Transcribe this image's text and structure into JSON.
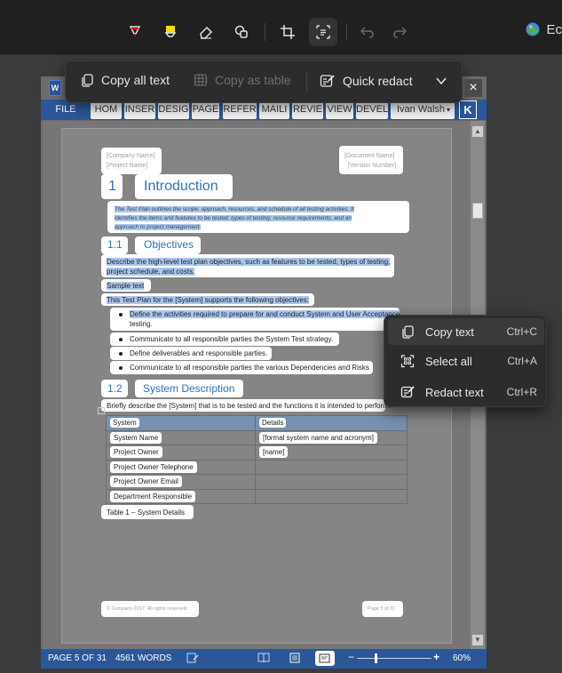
{
  "toolbar": {
    "right_label": "Ec"
  },
  "copy_bar": {
    "copy_all_text": "Copy all text",
    "copy_as_table": "Copy as table",
    "quick_redact": "Quick redact"
  },
  "close_label": "×",
  "ribbon": {
    "file": "FILE",
    "tabs": [
      "HOM",
      "INSER",
      "DESIG",
      "PAGE",
      "REFER",
      "MAILI",
      "REVIE",
      "VIEW",
      "DEVEL"
    ],
    "user": "Ivan Walsh",
    "user_initial": "K"
  },
  "document": {
    "company_name": "[Company Name]",
    "project_name": "[Project Name]",
    "document_name": "[Document Name]",
    "version_number": "[Version Number]",
    "h1_num": "1",
    "h1_title": "Introduction",
    "intro_line1": "The Test Plan outlines the scope, approach, resources, and schedule of all testing activities. It",
    "intro_line2": "identifies the items and features to be tested; types of testing; resource requirements; and an",
    "intro_line3": "approach to project management.",
    "h11_num": "1.1",
    "h11_title": "Objectives",
    "obj_line1": "Describe the high-level test plan objectives, such as features to be tested, types of testing,",
    "obj_line2": "project schedule, and costs.",
    "sample_text": "Sample text",
    "supports": "This Test Plan for the [System] supports the following objectives:",
    "bullets": [
      "Define the activities required to prepare for and conduct System and User Acceptance",
      "testing.",
      "Communicate to all responsible parties the System Test strategy.",
      "Define deliverables and responsible parties.",
      "Communicate to all responsible parties the various Dependencies and Risks"
    ],
    "h12_num": "1.2",
    "h12_title": "System Description",
    "sys_desc": "Briefly describe the [System] that is to be tested and the functions it is intended to perform.",
    "table": {
      "headers": [
        "System",
        "Details"
      ],
      "rows": [
        [
          "System Name",
          "[formal system name and acronym]"
        ],
        [
          "Project Owner",
          "[name]"
        ],
        [
          "Project Owner Telephone",
          ""
        ],
        [
          "Project Owner Email",
          ""
        ],
        [
          "Department Responsible",
          ""
        ]
      ],
      "caption": "Table 1 – System Details"
    },
    "footer_left": "© Company 2017. All rights reserved.",
    "footer_right": "Page 5 of 31"
  },
  "status": {
    "page": "PAGE 5 OF 31",
    "words": "4561 WORDS",
    "zoom": "60%"
  },
  "context_menu": {
    "items": [
      {
        "label": "Copy text",
        "shortcut": "Ctrl+C"
      },
      {
        "label": "Select all",
        "shortcut": "Ctrl+A"
      },
      {
        "label": "Redact text",
        "shortcut": "Ctrl+R"
      }
    ]
  },
  "colors": {
    "word_blue": "#2b579a",
    "heading_blue": "#2e74b5",
    "selection": "#a9c7ee"
  }
}
